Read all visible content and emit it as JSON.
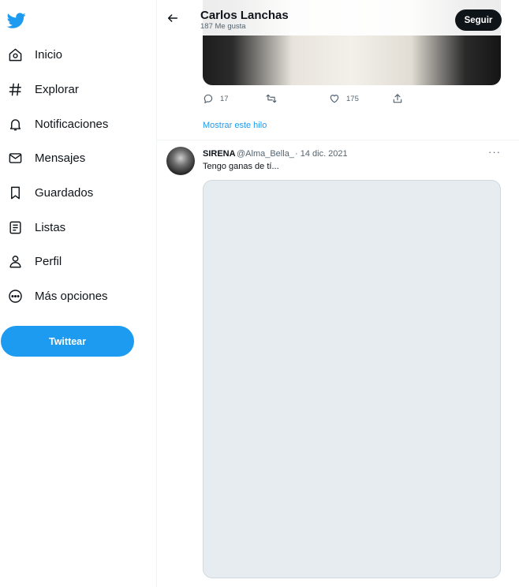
{
  "sidebar": {
    "logo_icon": "twitter-bird-icon",
    "items": [
      {
        "label": "Inicio",
        "icon": "home-icon"
      },
      {
        "label": "Explorar",
        "icon": "hashtag-icon"
      },
      {
        "label": "Notificaciones",
        "icon": "bell-icon"
      },
      {
        "label": "Mensajes",
        "icon": "envelope-icon"
      },
      {
        "label": "Guardados",
        "icon": "bookmark-icon"
      },
      {
        "label": "Listas",
        "icon": "list-icon"
      },
      {
        "label": "Perfil",
        "icon": "person-icon"
      },
      {
        "label": "Más opciones",
        "icon": "more-circle-icon"
      }
    ],
    "tweet_button": "Twittear"
  },
  "header": {
    "name": "Carlos Lanchas",
    "subtitle": "187 Me gusta",
    "follow_button": "Seguir"
  },
  "previous_tweet": {
    "replies": "17",
    "likes": "175",
    "show_thread": "Mostrar este hilo"
  },
  "tweet": {
    "name": "SIRENA",
    "handle": "@Alma_Bella_",
    "date": "· 14 dic. 2021",
    "text": "Tengo ganas de tí...",
    "more": "···"
  },
  "colors": {
    "accent": "#1d9bf0",
    "text": "#0f1419",
    "secondary": "#536471"
  }
}
